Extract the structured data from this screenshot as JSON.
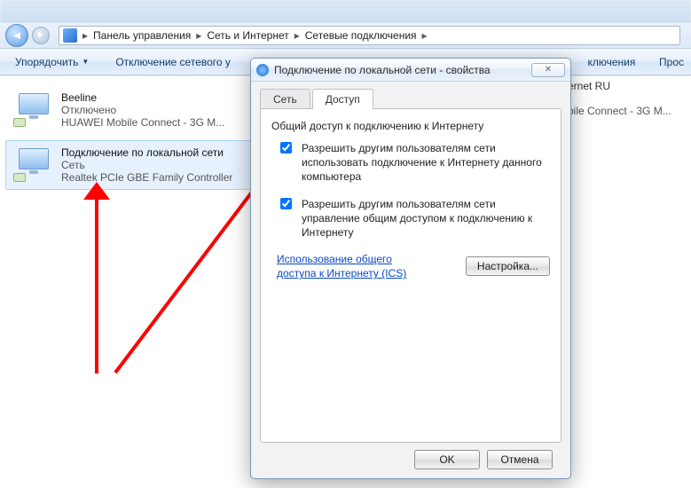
{
  "breadcrumb": {
    "items": [
      "Панель управления",
      "Сеть и Интернет",
      "Сетевые подключения"
    ]
  },
  "toolbar": {
    "organize": "Упорядочить",
    "disable": "Отключение сетевого у",
    "right_item_1": "ключения",
    "right_item_2": "Прос"
  },
  "connections": [
    {
      "name": "Beeline",
      "state": "Отключено",
      "device": "HUAWEI Mobile Connect - 3G M..."
    },
    {
      "name": "Подключение по локальной сети",
      "state": "Сеть",
      "device": "Realtek PCIe GBE Family Controller"
    }
  ],
  "ghost_connection": {
    "name_tail": "ernet RU",
    "device_tail": "bile Connect - 3G M..."
  },
  "dialog": {
    "title": "Подключение по локальной сети - свойства",
    "close_glyph": "✕",
    "tabs": {
      "network": "Сеть",
      "access": "Доступ"
    },
    "group_title": "Общий доступ к подключению к Интернету",
    "chk1": "Разрешить другим пользователям сети использовать подключение к Интернету данного компьютера",
    "chk2": "Разрешить другим пользователям сети управление общим доступом к подключению к Интернету",
    "link": "Использование общего доступа к Интернету (ICS)",
    "settings_btn": "Настройка...",
    "ok": "OK",
    "cancel": "Отмена"
  }
}
